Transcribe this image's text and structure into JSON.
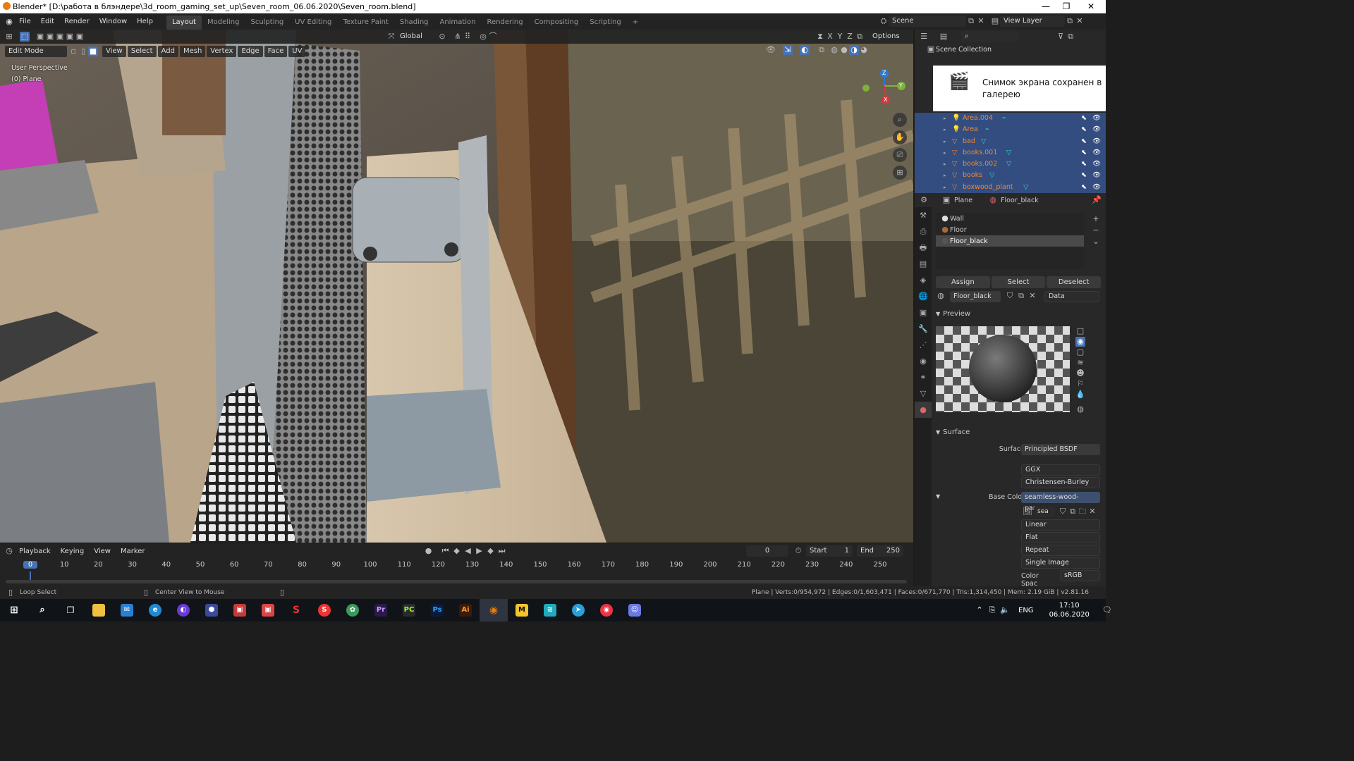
{
  "window": {
    "title": "Blender* [D:\\работа в блэндере\\3d_room_gaming_set_up\\Seven_room_06.06.2020\\Seven_room.blend]",
    "minimize": "—",
    "maximize": "❐",
    "close": "✕"
  },
  "menu": [
    "File",
    "Edit",
    "Render",
    "Window",
    "Help"
  ],
  "workspaces": [
    "Layout",
    "Modeling",
    "Sculpting",
    "UV Editing",
    "Texture Paint",
    "Shading",
    "Animation",
    "Rendering",
    "Compositing",
    "Scripting"
  ],
  "workspace_add": "+",
  "scene": {
    "label": "Scene",
    "view_layer": "View Layer"
  },
  "viewport": {
    "transform_orientation": "Global",
    "axes": [
      "X",
      "Y",
      "Z"
    ],
    "options": "Options",
    "mode": "Edit Mode",
    "header_menus": [
      "View",
      "Select",
      "Add",
      "Mesh",
      "Vertex",
      "Edge",
      "Face",
      "UV"
    ],
    "overlay_text_1": "User Perspective",
    "overlay_text_2": "(0) Plane",
    "gizmo": {
      "x": "X",
      "y": "Y",
      "z": "Z"
    }
  },
  "outliner": {
    "title": "Scene Collection",
    "notification": "Снимок экрана сохранен в галерею",
    "items": [
      "Area.004",
      "Area",
      "bad",
      "books.001",
      "books.002",
      "books",
      "boxwood_plant"
    ]
  },
  "properties": {
    "breadcrumb_object": "Plane",
    "breadcrumb_material": "Floor_black",
    "slots": [
      "Wall",
      "Floor",
      "Floor_black"
    ],
    "selected_slot": "Floor_black",
    "assign": "Assign",
    "select": "Select",
    "deselect": "Deselect",
    "material_name": "Floor_black",
    "link": "Data",
    "preview_title": "Preview",
    "surface_title": "Surface",
    "surface_label": "Surface",
    "surface_value": "Principled BSDF",
    "distribution": "GGX",
    "subsurface_method": "Christensen-Burley",
    "base_color_label": "Base Color",
    "base_color_value": "seamless-wood-parq...",
    "image_name": "sea",
    "interpolation": "Linear",
    "projection": "Flat",
    "extension": "Repeat",
    "source": "Single Image",
    "color_space_label": "Color Spac",
    "color_space_value": "sRGB"
  },
  "timeline": {
    "menus": [
      "Playback",
      "Keying",
      "View",
      "Marker"
    ],
    "current_frame": "0",
    "start_label": "Start",
    "start": "1",
    "end_label": "End",
    "end": "250",
    "ticks": [
      "0",
      "10",
      "20",
      "30",
      "40",
      "50",
      "60",
      "70",
      "80",
      "90",
      "100",
      "110",
      "120",
      "130",
      "140",
      "150",
      "160",
      "170",
      "180",
      "190",
      "200",
      "210",
      "220",
      "230",
      "240",
      "250"
    ]
  },
  "status": {
    "loop_select": "Loop Select",
    "center_view": "Center View to Mouse",
    "stats": "Plane | Verts:0/954,972 | Edges:0/1,603,471 | Faces:0/671,770 | Tris:1,314,450 | Mem: 2.19 GiB | v2.81.16"
  },
  "taskbar": {
    "lang": "ENG",
    "time": "17:10",
    "date": "06.06.2020"
  },
  "colors": {
    "accent": "#4772b3",
    "selection_row": "#334d80",
    "active_ws": "#3c3c3c"
  }
}
